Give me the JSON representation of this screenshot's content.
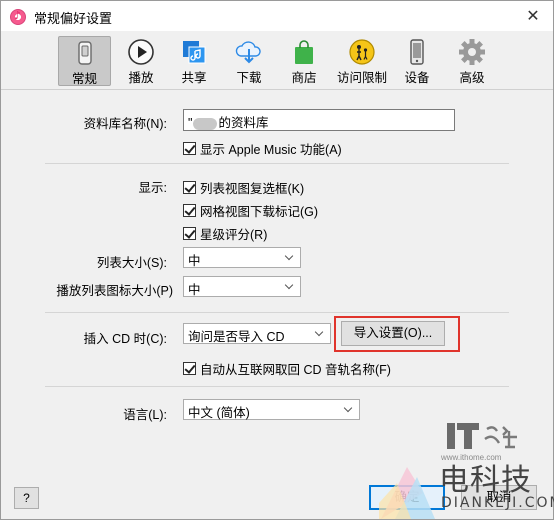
{
  "window": {
    "title": "常规偏好设置",
    "close_glyph": "✕"
  },
  "toolbar": {
    "tabs": [
      {
        "label": "常规",
        "icon": "general-icon",
        "active": true
      },
      {
        "label": "播放",
        "icon": "play-icon",
        "active": false
      },
      {
        "label": "共享",
        "icon": "sharing-icon",
        "active": false
      },
      {
        "label": "下载",
        "icon": "download-icon",
        "active": false
      },
      {
        "label": "商店",
        "icon": "store-bag-icon",
        "active": false
      },
      {
        "label": "访问限制",
        "icon": "restrictions-icon",
        "active": false
      },
      {
        "label": "设备",
        "icon": "device-icon",
        "active": false
      },
      {
        "label": "高级",
        "icon": "gear-icon",
        "active": false
      }
    ]
  },
  "library": {
    "name_label": "资料库名称(N):",
    "name_value_prefix": "\"",
    "name_value_suffix": "的资料库",
    "show_apple_music_label": "显示 Apple Music 功能(A)",
    "show_apple_music_checked": true
  },
  "display": {
    "label": "显示:",
    "options": [
      {
        "label": "列表视图复选框(K)",
        "checked": true
      },
      {
        "label": "网格视图下载标记(G)",
        "checked": true
      },
      {
        "label": "星级评分(R)",
        "checked": true
      }
    ],
    "list_size_label": "列表大小(S):",
    "list_size_value": "中",
    "playlist_icon_size_label": "播放列表图标大小(P)",
    "playlist_icon_size_value": "中"
  },
  "cd": {
    "insert_label": "插入 CD 时(C):",
    "insert_value": "询问是否导入 CD",
    "import_settings_button": "导入设置(O)...",
    "auto_retrieve_label": "自动从互联网取回 CD 音轨名称(F)",
    "auto_retrieve_checked": true
  },
  "language": {
    "label": "语言(L):",
    "value": "中文 (简体)"
  },
  "footer": {
    "help_label": "?",
    "ok_label": "确定",
    "cancel_label": "取消"
  },
  "watermarks": {
    "ithome_logo": "IT之家",
    "ithome_url": "www.ithome.com",
    "dianke_cn": "电科技",
    "dianke_en": "DIANKEJI.COM"
  },
  "colors": {
    "highlight_box": "#e0342c",
    "ok_border": "#0078d7"
  }
}
